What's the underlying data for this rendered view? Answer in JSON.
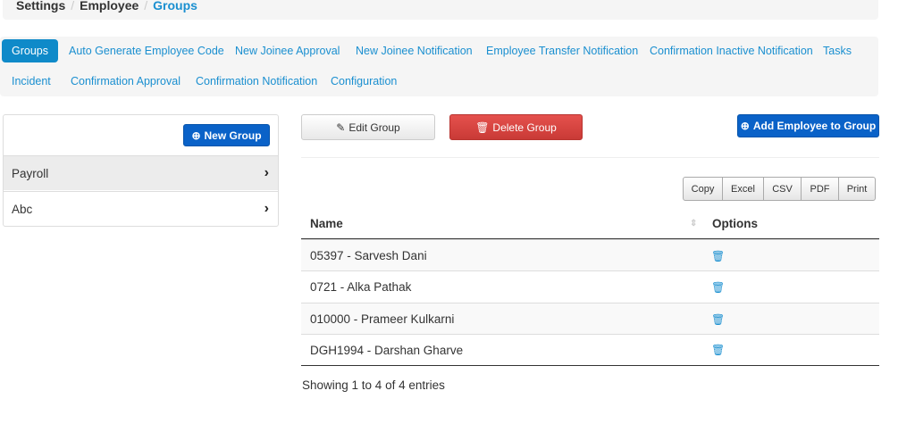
{
  "breadcrumb": [
    "Settings",
    "Employee",
    "Groups"
  ],
  "tabs": [
    "Groups",
    "Auto Generate Employee Code",
    "New Joinee Approval",
    "New Joinee Notification",
    "Employee Transfer Notification",
    "Confirmation Inactive Notification",
    "Tasks",
    "Incident",
    "Confirmation Approval",
    "Confirmation Notification",
    "Configuration"
  ],
  "left": {
    "new_group": "New Group",
    "groups": [
      "Payroll",
      "Abc"
    ]
  },
  "actions": {
    "edit": "Edit Group",
    "delete": "Delete Group",
    "add": "Add Employee to Group"
  },
  "export": [
    "Copy",
    "Excel",
    "CSV",
    "PDF",
    "Print"
  ],
  "table": {
    "headers": [
      "Name",
      "Options"
    ],
    "rows": [
      "05397 - Sarvesh Dani",
      "0721 - Alka Pathak",
      "010000 - Prameer Kulkarni",
      "DGH1994 - Darshan Gharve"
    ]
  },
  "footer": "Showing 1 to 4 of 4 entries",
  "colors": {
    "accent": "#1a8fd0",
    "primary": "#0a62c8",
    "danger": "#d9403c"
  }
}
